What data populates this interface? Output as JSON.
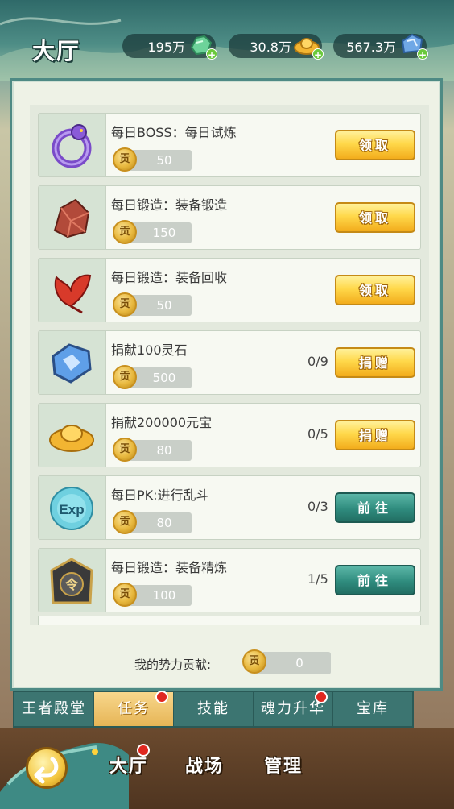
{
  "header": {
    "title": "大厅",
    "currencies": [
      {
        "value": "195万",
        "icon": "jade-icon",
        "color": "#6dd39a"
      },
      {
        "value": "30.8万",
        "icon": "gold-ingot-icon",
        "color": "#f2b532"
      },
      {
        "value": "567.3万",
        "icon": "spirit-stone-icon",
        "color": "#6fa8e6"
      }
    ]
  },
  "tasks": [
    {
      "title": "每日BOSS：每日试炼",
      "reward_icon": "贡",
      "reward": "50",
      "progress": "",
      "button": "领取",
      "button_style": "gold",
      "icon": "purple-dragon-icon"
    },
    {
      "title": "每日锻造：装备锻造",
      "reward_icon": "贡",
      "reward": "150",
      "progress": "",
      "button": "领取",
      "button_style": "gold",
      "icon": "ore-icon"
    },
    {
      "title": "每日锻造：装备回收",
      "reward_icon": "贡",
      "reward": "50",
      "progress": "",
      "button": "领取",
      "button_style": "gold",
      "icon": "red-leaf-icon"
    },
    {
      "title": "捐献100灵石",
      "reward_icon": "贡",
      "reward": "500",
      "progress": "0/9",
      "button": "捐赠",
      "button_style": "gold",
      "icon": "spirit-stone-icon"
    },
    {
      "title": "捐献200000元宝",
      "reward_icon": "贡",
      "reward": "80",
      "progress": "0/5",
      "button": "捐赠",
      "button_style": "gold",
      "icon": "gold-ingot-icon"
    },
    {
      "title": "每日PK:进行乱斗",
      "reward_icon": "贡",
      "reward": "80",
      "progress": "0/3",
      "button": "前往",
      "button_style": "teal",
      "icon": "exp-orb-icon",
      "icon_text": "Exp"
    },
    {
      "title": "每日锻造：装备精炼",
      "reward_icon": "贡",
      "reward": "100",
      "progress": "1/5",
      "button": "前往",
      "button_style": "teal",
      "icon": "order-token-icon",
      "icon_text": "令"
    }
  ],
  "contribution": {
    "label": "我的势力贡献:",
    "coin": "贡",
    "value": "0"
  },
  "tabs": [
    {
      "label": "王者殿堂",
      "active": false,
      "dot": false
    },
    {
      "label": "任务",
      "active": true,
      "dot": true
    },
    {
      "label": "技能",
      "active": false,
      "dot": false
    },
    {
      "label": "魂力升华",
      "active": false,
      "dot": true
    },
    {
      "label": "宝库",
      "active": false,
      "dot": false
    }
  ],
  "bottom_nav": {
    "items": [
      "大厅",
      "战场",
      "管理"
    ],
    "dot_on": "大厅"
  }
}
